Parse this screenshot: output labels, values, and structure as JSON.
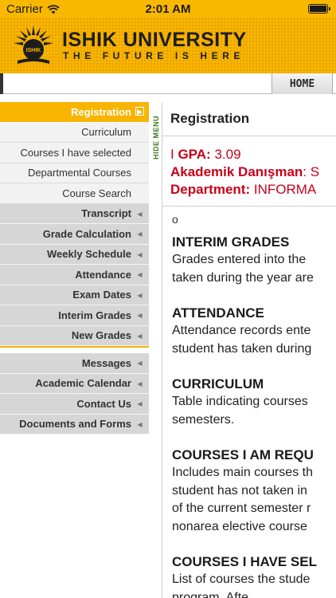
{
  "status_bar": {
    "carrier": "Carrier",
    "time": "2:01 AM"
  },
  "header": {
    "university_name": "ISHIK UNIVERSITY",
    "tagline": "THE FUTURE IS HERE",
    "logo_text": "ISHIK",
    "brand_color": "#f7b500"
  },
  "nav": {
    "home_label": "HOME"
  },
  "hide_menu_label": "HIDE MENU",
  "sidebar": {
    "active_item": {
      "label": "Registration",
      "icon": "arrow-right-box-icon"
    },
    "sub_items": [
      {
        "label": "Curriculum"
      },
      {
        "label": "Courses I have selected"
      },
      {
        "label": "Departmental Courses"
      },
      {
        "label": "Course Search"
      }
    ],
    "main_items": [
      {
        "label": "Transcript"
      },
      {
        "label": "Grade Calculation"
      },
      {
        "label": "Weekly Schedule"
      },
      {
        "label": "Attendance"
      },
      {
        "label": "Exam Dates"
      },
      {
        "label": "Interim Grades"
      },
      {
        "label": "New Grades"
      }
    ],
    "secondary_items": [
      {
        "label": "Messages"
      },
      {
        "label": "Academic Calendar"
      },
      {
        "label": "Contact Us"
      },
      {
        "label": "Documents and Forms"
      }
    ]
  },
  "content": {
    "title": "Registration",
    "gpa_prefix": "I ",
    "gpa_label": "GPA:",
    "gpa_value": "3.09",
    "advisor_label": "Akademik Danışman",
    "advisor_value": ": S",
    "department_label": "Department:",
    "department_value": "INFORMA",
    "bullet": "o",
    "sections": [
      {
        "heading": "INTERIM GRADES",
        "lines": [
          "Grades entered into the",
          "taken during the year are"
        ]
      },
      {
        "heading": "ATTENDANCE",
        "lines": [
          "Attendance records ente",
          "student has taken during"
        ]
      },
      {
        "heading": "CURRICULUM",
        "lines": [
          "Table indicating courses",
          "semesters."
        ]
      },
      {
        "heading": "COURSES I AM REQU",
        "lines": [
          "Includes main courses th",
          "student has not taken in",
          "of the current semester r",
          "nonarea elective course"
        ]
      },
      {
        "heading": "COURSES I HAVE SEL",
        "lines": [
          "List of courses the stude",
          "program. Afte"
        ]
      }
    ]
  }
}
